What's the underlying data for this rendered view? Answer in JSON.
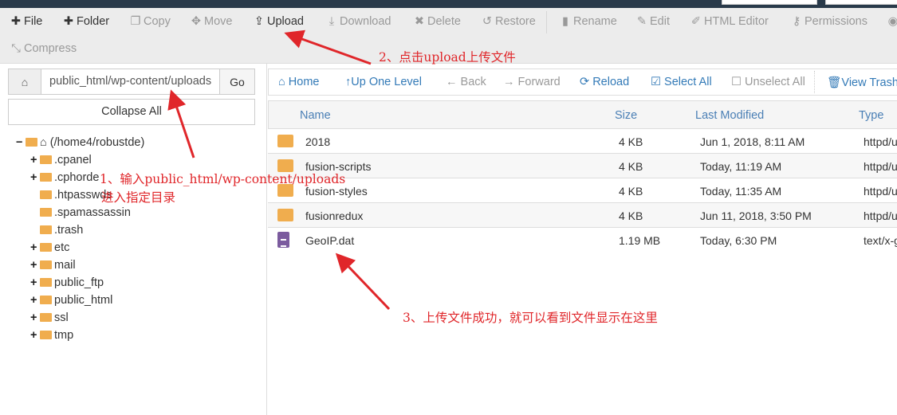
{
  "toolbar": {
    "items": [
      {
        "label": "File",
        "icon": "plus-icon",
        "enabled": true
      },
      {
        "label": "Folder",
        "icon": "plus-icon",
        "enabled": true
      },
      {
        "label": "Copy",
        "icon": "copy-icon",
        "enabled": false
      },
      {
        "label": "Move",
        "icon": "move-icon",
        "enabled": false
      },
      {
        "label": "Upload",
        "icon": "upload-icon",
        "enabled": true
      },
      {
        "label": "Download",
        "icon": "download-icon",
        "enabled": false
      },
      {
        "label": "Delete",
        "icon": "x-icon",
        "enabled": false
      },
      {
        "label": "Restore",
        "icon": "undo-icon",
        "enabled": false
      },
      {
        "label": "Rename",
        "icon": "file-icon",
        "enabled": false
      },
      {
        "label": "Edit",
        "icon": "pencil-icon",
        "enabled": false
      },
      {
        "label": "HTML Editor",
        "icon": "edit-icon",
        "enabled": false
      },
      {
        "label": "Permissions",
        "icon": "key-icon",
        "enabled": false
      },
      {
        "label": "Compress",
        "icon": "compress-icon",
        "enabled": false
      }
    ]
  },
  "path": {
    "value": "public_html/wp-content/uploads",
    "go": "Go"
  },
  "collapse_all": "Collapse All",
  "tree": {
    "root": "(/home4/robustde)",
    "items": [
      ".cpanel",
      ".cphorde",
      ".htpasswds",
      ".spamassassin",
      ".trash",
      "etc",
      "mail",
      "public_ftp",
      "public_html",
      "ssl",
      "tmp"
    ]
  },
  "nav": [
    "Home",
    "Up One Level",
    "Back",
    "Forward",
    "Reload",
    "Select All",
    "Unselect All",
    "View Trash"
  ],
  "table": {
    "headers": [
      "Name",
      "Size",
      "Last Modified",
      "Type"
    ],
    "rows": [
      {
        "name": "2018",
        "size": "4 KB",
        "modified": "Jun 1, 2018, 8:11 AM",
        "type": "httpd/u",
        "kind": "folder"
      },
      {
        "name": "fusion-scripts",
        "size": "4 KB",
        "modified": "Today, 11:19 AM",
        "type": "httpd/u",
        "kind": "folder"
      },
      {
        "name": "fusion-styles",
        "size": "4 KB",
        "modified": "Today, 11:35 AM",
        "type": "httpd/u",
        "kind": "folder"
      },
      {
        "name": "fusionredux",
        "size": "4 KB",
        "modified": "Jun 11, 2018, 3:50 PM",
        "type": "httpd/u",
        "kind": "folder"
      },
      {
        "name": "GeoIP.dat",
        "size": "1.19 MB",
        "modified": "Today, 6:30 PM",
        "type": "text/x-g",
        "kind": "file"
      }
    ]
  },
  "annotations": {
    "step1_line1": "1、输入public_html/wp-content/uploads",
    "step1_line2": "进入指定目录",
    "step2": "2、点击upload上传文件",
    "step3": "3、上传文件成功，就可以看到文件显示在这里"
  },
  "colors": {
    "link": "#337ab7",
    "folder": "#f0ad4e",
    "annotation": "#e0262a",
    "topbar": "#293a4a"
  }
}
